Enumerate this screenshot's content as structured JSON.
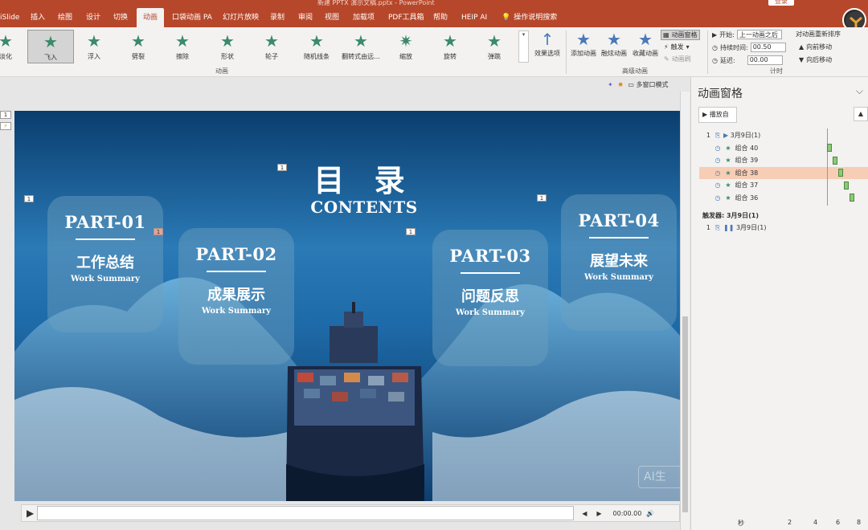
{
  "titlebar": {
    "text": "新建 PPTX 演示文稿.pptx - PowerPoint",
    "login": "登录"
  },
  "tabs": [
    "iSlide",
    "插入",
    "绘图",
    "设计",
    "切换",
    "动画",
    "口袋动画 PA",
    "幻灯片放映",
    "录制",
    "审阅",
    "视图",
    "加载项",
    "PDF工具箱",
    "帮助",
    "HEIP AI",
    "操作说明搜索"
  ],
  "active_tab": "动画",
  "ribbon": {
    "effects": [
      {
        "label": "淡化",
        "color": "#3b8a6b"
      },
      {
        "label": "飞入",
        "color": "#3b8a6b",
        "selected": true
      },
      {
        "label": "浮入",
        "color": "#3b8a6b"
      },
      {
        "label": "劈裂",
        "color": "#3b8a6b"
      },
      {
        "label": "擦除",
        "color": "#3b8a6b"
      },
      {
        "label": "形状",
        "color": "#3b8a6b"
      },
      {
        "label": "轮子",
        "color": "#3b8a6b"
      },
      {
        "label": "随机线条",
        "color": "#3b8a6b"
      },
      {
        "label": "翻转式由远...",
        "color": "#3b8a6b"
      },
      {
        "label": "缩放",
        "color": "#3b8a6b"
      },
      {
        "label": "旋转",
        "color": "#3b8a6b"
      },
      {
        "label": "弹跳",
        "color": "#3b8a6b"
      }
    ],
    "effect_options": "效果选项",
    "group_animation": "动画",
    "add_animation": "添加动画",
    "painter": "融炫动画",
    "favorite": "收藏动画",
    "anim_pane_btn": "动画窗格",
    "trigger": "触发",
    "anim_brush": "动画刷",
    "group_advanced": "高级动画",
    "start_label": "开始:",
    "start_value": "上一动画之后",
    "duration_label": "持续时间:",
    "duration_value": "00.50",
    "delay_label": "延迟:",
    "delay_value": "00.00",
    "reorder": "对动画重新排序",
    "move_earlier": "向前移动",
    "move_later": "向后移动",
    "group_timing": "计时"
  },
  "editor": {
    "multiwin": "多窗口模式",
    "play_time": "00:00.00"
  },
  "slide": {
    "title_zh": "目 录",
    "title_en": "CONTENTS",
    "watermark": "AI生",
    "tags": [
      "1",
      "1",
      "1",
      "1",
      "1",
      "1"
    ],
    "cards": [
      {
        "part": "PART-01",
        "zh": "工作总结",
        "en": "Work Summary"
      },
      {
        "part": "PART-02",
        "zh": "成果展示",
        "en": "Work Summary"
      },
      {
        "part": "PART-03",
        "zh": "问题反思",
        "en": "Work Summary"
      },
      {
        "part": "PART-04",
        "zh": "展望未来",
        "en": "Work Summary"
      }
    ]
  },
  "gutter": [
    "1",
    "⚡"
  ],
  "pane": {
    "title": "动画窗格",
    "play_from": "播放自",
    "rows": [
      {
        "num": "1",
        "label": "3月9日(1)",
        "kind": "play"
      },
      {
        "num": "",
        "label": "组合 40",
        "kind": "star"
      },
      {
        "num": "",
        "label": "组合 39",
        "kind": "star"
      },
      {
        "num": "",
        "label": "组合 38",
        "kind": "star",
        "highlight": true
      },
      {
        "num": "",
        "label": "组合 37",
        "kind": "star"
      },
      {
        "num": "",
        "label": "组合 36",
        "kind": "star"
      }
    ],
    "trigger_label": "触发器: 3月9日(1)",
    "trigger_row": {
      "num": "1",
      "label": "3月9日(1)"
    },
    "bottom_sec": "秒",
    "bottom_ticks": [
      "2",
      "4",
      "6",
      "8"
    ]
  }
}
